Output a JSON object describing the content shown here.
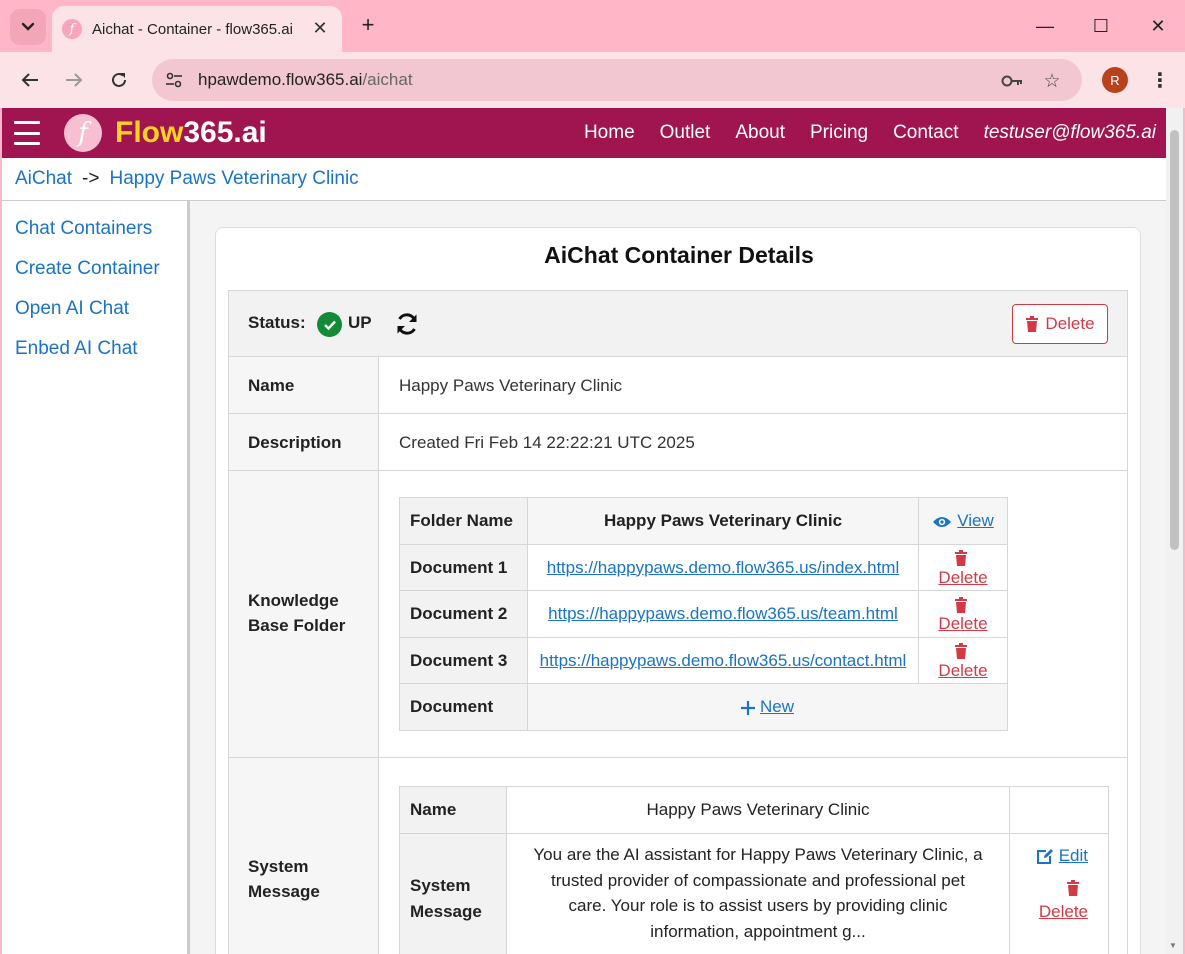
{
  "browser": {
    "tab_title": "Aichat - Container - flow365.ai",
    "tab_favicon": "f",
    "url_host": "hpawdemo.flow365.ai",
    "url_path": "/aichat",
    "profile_initial": "R"
  },
  "appbar": {
    "logo_letter": "f",
    "brand_accent": "Flow",
    "brand_rest": "365.ai",
    "nav": [
      "Home",
      "Outlet",
      "About",
      "Pricing",
      "Contact"
    ],
    "user": "testuser@flow365.ai",
    "colors": {
      "bar": "#a0154f",
      "accent": "#ffd21f"
    }
  },
  "breadcrumb": {
    "root": "AiChat",
    "separator": "->",
    "current": "Happy Paws Veterinary Clinic"
  },
  "sidebar": {
    "items": [
      "Chat Containers",
      "Create Container",
      "Open AI Chat",
      "Enbed AI Chat"
    ]
  },
  "card": {
    "title": "AiChat Container Details",
    "status_label": "Status:",
    "status_value": "UP",
    "delete_label": "Delete",
    "rows": {
      "name_label": "Name",
      "name_value": "Happy Paws Veterinary Clinic",
      "description_label": "Description",
      "description_value": "Created Fri Feb 14 22:22:21 UTC 2025",
      "kb_label": "Knowledge Base Folder",
      "sysmsg_label": "System Message"
    },
    "kb": {
      "folder_label": "Folder Name",
      "folder_value": "Happy Paws Veterinary Clinic",
      "view_label": "View",
      "documents": [
        {
          "label": "Document 1",
          "url": "https://happypaws.demo.flow365.us/index.html",
          "action": "Delete"
        },
        {
          "label": "Document 2",
          "url": "https://happypaws.demo.flow365.us/team.html",
          "action": "Delete"
        },
        {
          "label": "Document 3",
          "url": "https://happypaws.demo.flow365.us/contact.html",
          "action": "Delete"
        }
      ],
      "new_label": "Document",
      "new_action": "New"
    },
    "sysmsg": {
      "name_label": "Name",
      "name_value": "Happy Paws Veterinary Clinic",
      "msg_label": "System Message",
      "msg_value": "You are the AI assistant for Happy Paws Veterinary Clinic, a trusted provider of compassionate and professional pet care. Your role is to assist users by providing clinic information, appointment g...",
      "edit_label": "Edit",
      "delete_label": "Delete"
    }
  }
}
